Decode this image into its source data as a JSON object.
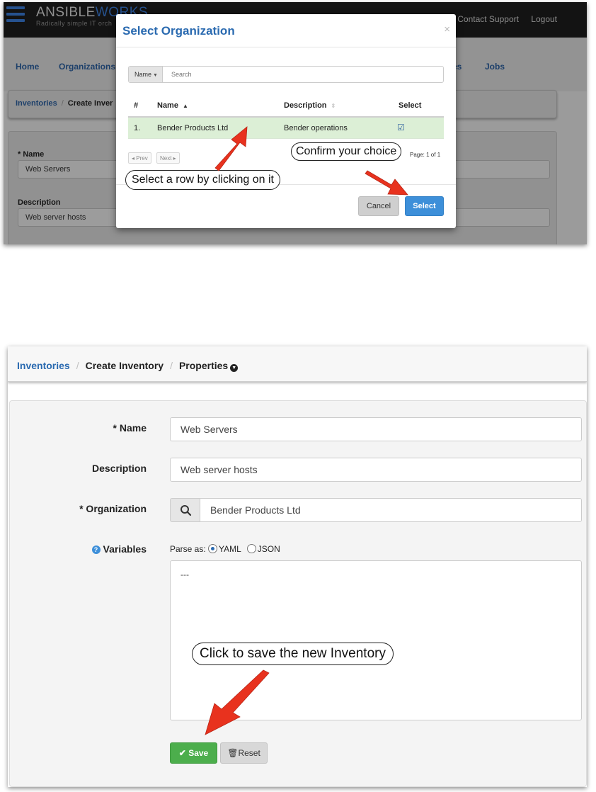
{
  "top": {
    "header": {
      "logo_main": "ANSIBLE",
      "logo_accent": "WORKS",
      "tagline": "Radically simple IT orch",
      "links": [
        "Contact Support",
        "Logout"
      ]
    },
    "nav": [
      "Home",
      "Organizations",
      "es",
      "Jobs"
    ],
    "breadcrumb": {
      "link": "Inventories",
      "separator": "/",
      "current": "Create Inver"
    },
    "form": {
      "name_label": "* Name",
      "name_value": "Web Servers",
      "description_label": "Description",
      "description_value": "Web server hosts"
    },
    "modal": {
      "title": "Select Organization",
      "close": "×",
      "search": {
        "field_label": "Name",
        "placeholder": "Search"
      },
      "columns": [
        "#",
        "Name",
        "Description",
        "Select"
      ],
      "rows": [
        {
          "num": "1.",
          "name": "Bender Products Ltd",
          "description": "Bender operations",
          "selected": true
        }
      ],
      "pagination": {
        "prev": "Prev",
        "next": "Next",
        "info": "Page: 1 of 1"
      },
      "buttons": {
        "cancel": "Cancel",
        "select": "Select"
      }
    },
    "callouts": {
      "row": "Select a row by clicking on it",
      "confirm": "Confirm your choice"
    }
  },
  "bottom": {
    "breadcrumb": {
      "link": "Inventories",
      "separator": "/",
      "middle": "Create Inventory",
      "current": "Properties"
    },
    "form": {
      "name_label": "* Name",
      "name_value": "Web Servers",
      "description_label": "Description",
      "description_value": "Web server hosts",
      "organization_label": "* Organization",
      "organization_value": "Bender Products Ltd",
      "variables_label": "Variables",
      "parse_label": "Parse as:",
      "parse_options": [
        "YAML",
        "JSON"
      ],
      "parse_selected": "YAML",
      "variables_value": "---"
    },
    "buttons": {
      "save": "Save",
      "reset": "Reset"
    },
    "callout": "Click to save the new Inventory"
  },
  "colors": {
    "arrow": "#e8321e",
    "link_blue": "#2a6ab0",
    "select_button": "#3d8fd9",
    "save_button": "#4cae4c",
    "selected_row": "#dcefd6"
  }
}
